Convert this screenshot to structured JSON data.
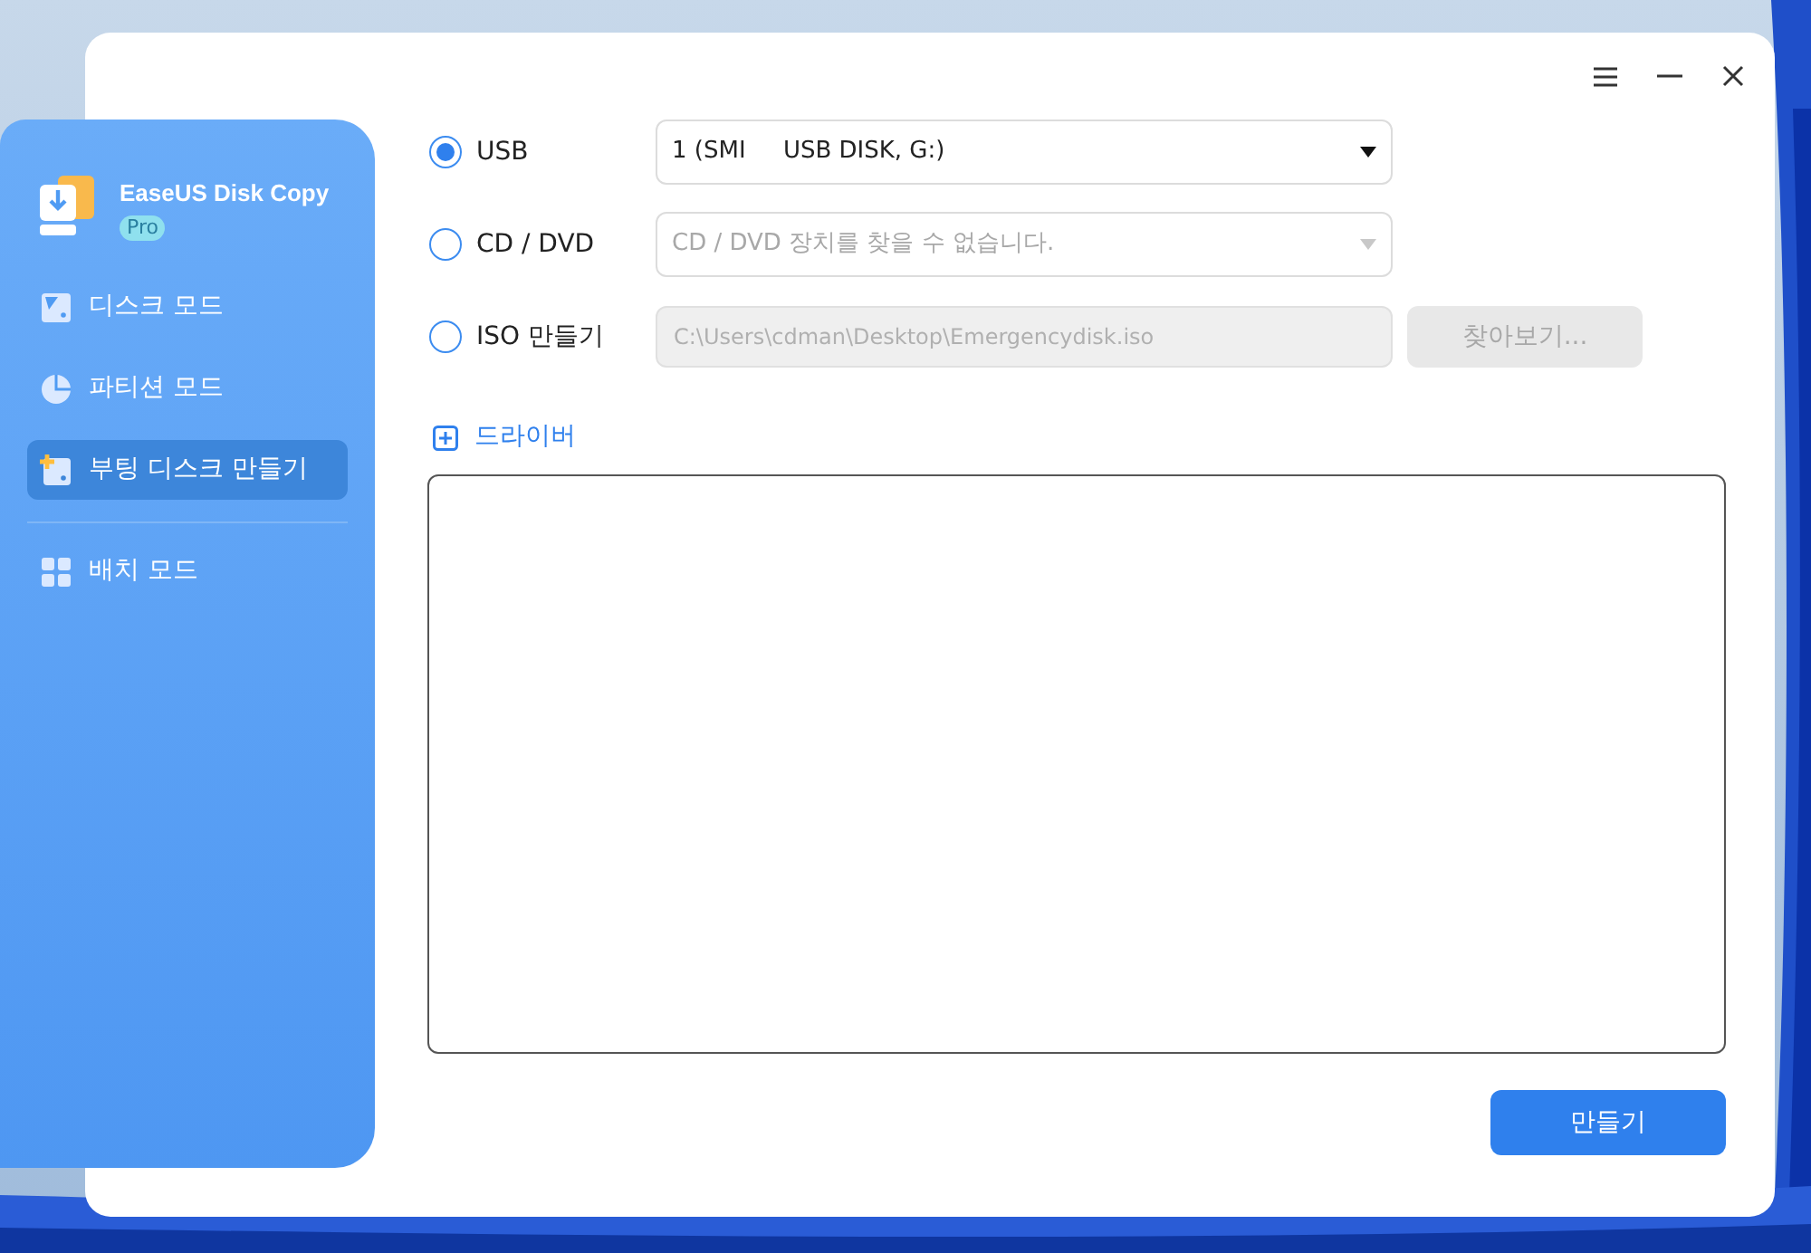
{
  "sidebar": {
    "app_name": "EaseUS Disk Copy",
    "edition": "Pro",
    "items": [
      {
        "label": "디스크 모드",
        "selected": false
      },
      {
        "label": "파티션 모드",
        "selected": false
      },
      {
        "label": "부팅 디스크 만들기",
        "selected": true
      },
      {
        "label": "배치 모드",
        "selected": false
      }
    ]
  },
  "sources": [
    {
      "kind": "select",
      "label": "USB",
      "selected": true,
      "value": "1 (SMI     USB DISK, G:)",
      "disabled": false
    },
    {
      "kind": "select",
      "label": "CD / DVD",
      "selected": false,
      "value": "CD / DVD 장치를 찾을 수 없습니다.",
      "disabled": true
    },
    {
      "kind": "path",
      "label": "ISO 만들기",
      "selected": false,
      "value": "C:\\Users\\cdman\\Desktop\\Emergencydisk.iso",
      "disabled": true,
      "button": "찾아보기..."
    }
  ],
  "driver": {
    "label": "드라이버"
  },
  "create_button": "만들기"
}
